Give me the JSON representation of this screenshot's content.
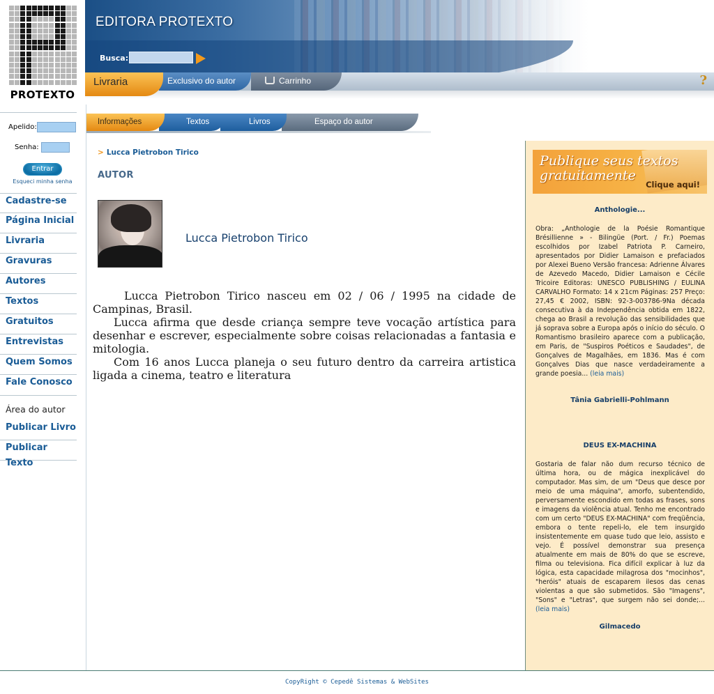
{
  "logo": {
    "text": "PROTEXTO"
  },
  "header": {
    "site_title": "EDITORA PROTEXTO",
    "search_label": "Busca:",
    "search_value": "",
    "tabs": [
      {
        "label": "Livraria",
        "active": true
      },
      {
        "label": "Exclusivo do autor"
      },
      {
        "label": "Carrinho",
        "icon": "cart-icon"
      }
    ],
    "help_icon": "help-icon"
  },
  "login": {
    "apelido_label": "Apelido:",
    "senha_label": "Senha:",
    "button_label": "Entrar",
    "forgot_label": "Esqueci minha senha"
  },
  "nav": {
    "items": [
      "Cadastre-se",
      "Página Inicial",
      "Livraria",
      "Gravuras",
      "Autores",
      "Textos",
      "Gratuitos",
      "Entrevistas",
      "Quem Somos",
      "Fale Conosco"
    ],
    "author_heading": "Área do autor",
    "author_items": [
      "Publicar Livro",
      "Publicar Texto"
    ]
  },
  "subtabs": [
    "Informações",
    "Textos",
    "Livros",
    "Espaço do autor"
  ],
  "main": {
    "breadcrumb": "Lucca Pietrobon Tirico",
    "section_title": "AUTOR",
    "author_name": "Lucca Pietrobon Tirico",
    "bio": [
      "Lucca Pietrobon Tirico nasceu em 02 / 06 / 1995 na cidade de Campinas, Brasil.",
      "Lucca afirma que desde criança sempre teve vocação artística para desenhar e escrever, especialmente sobre coisas relacionadas a fantasia e mitologia.",
      "Com 16 anos Lucca planeja o seu futuro dentro da carreira artistica ligada a cinema, teatro e literatura"
    ]
  },
  "right": {
    "promo": {
      "title_line1": "Publique seus textos",
      "title_line2": "gratuitamente",
      "cta": "Clique aqui!"
    },
    "articles": [
      {
        "title": "Anthologie...",
        "body": "Obra: „Anthologie de la Poésie Romantique Brésillienne » - Bilingüe (Port. / Fr.) Poemas escolhidos por Izabel Patriota P. Carneiro, apresentados por Didier Lamaison e prefaciados por Alexei Bueno Versão francesa: Adrienne Álvares de Azevedo Macedo, Didier Lamaison e Cécile Tricoire Editoras: UNESCO PUBLISHING / EULINA CARVALHO Formato: 14 x 21cm Páginas: 257 Preço: 27,45 € 2002, ISBN: 92-3-003786-9Na década consecutiva à da Independência obtida em 1822, chega ao Brasil a revolução das sensibilidades que já soprava sobre a Europa após o início do século. O Romantismo brasileiro aparece com a publicação, em Paris, de \"Suspiros Poéticos e Saudades\", de Gonçalves de Magalhães, em 1836. Mas é com Gonçalves Dias que nasce verdadeiramente a grande poesia...",
        "more": "(leia mais)",
        "author": "Tânia Gabrielli-Pohlmann"
      },
      {
        "title": "DEUS EX-MACHINA",
        "body": "Gostaria de falar não dum recurso técnico de última hora, ou de mágica inexplicável do computador. Mas sim, de um \"Deus que desce por meio de uma máquina\", amorfo, subentendido, perversamente escondido em todas as frases, sons e imagens da violência atual. Tenho me encontrado com um certo \"DEUS EX-MACHINA\" com freqüência, embora o tente repeli-lo, ele tem insurgido insistentemente em quase tudo que leio, assisto e vejo. É possível demonstrar sua presença atualmente em mais de 80% do que se escreve, filma ou televisiona. Fica difícil explicar à luz da lógica, esta capacidade milagrosa dos \"mocinhos\", \"heróis\" atuais de escaparem ilesos das cenas violentas a que são submetidos. São \"Imagens\", \"Sons\" e \"Letras\", que surgem não sei donde;...",
        "more": "(leia mais)",
        "author": "Gilmacedo"
      }
    ]
  },
  "footer": {
    "text": "CopyRight © Cepedê Sistemas & WebSites"
  }
}
